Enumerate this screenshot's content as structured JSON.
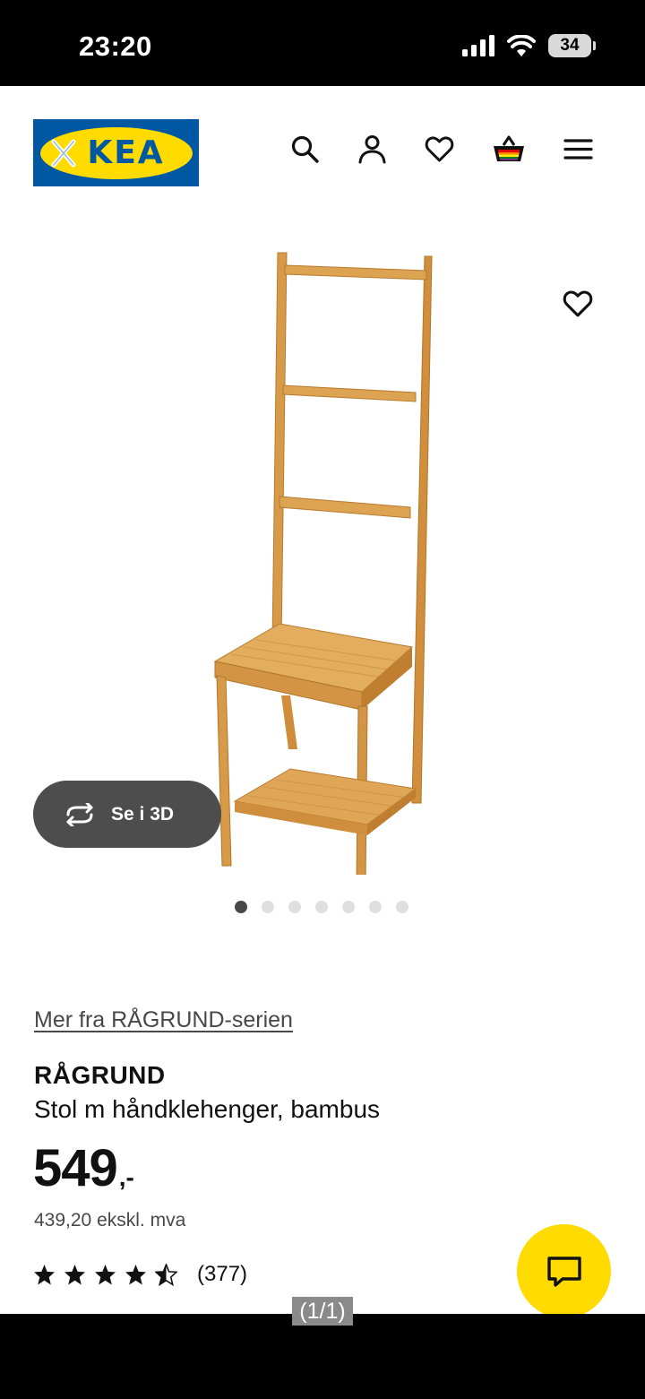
{
  "status_bar": {
    "time": "23:20",
    "battery": "34"
  },
  "header": {
    "logo_text": "KEA",
    "icons": [
      "search-icon",
      "user-icon",
      "heart-icon",
      "basket-icon",
      "menu-icon"
    ]
  },
  "gallery": {
    "view_3d_label": "Se i 3D",
    "image_count": 7,
    "active_index": 0
  },
  "product": {
    "series_link": "Mer fra RÅGRUND-serien",
    "name": "RÅGRUND",
    "description": "Stol m håndklehenger, bambus",
    "price_main": "549",
    "price_suffix": ",-",
    "price_ex_vat": "439,20 ekskl. mva",
    "rating_stars": 4.5,
    "rating_count": "(377)"
  },
  "viewer": {
    "page_indicator": "(1/1)"
  },
  "colors": {
    "ikea_blue": "#0058a3",
    "ikea_yellow": "#ffdb00",
    "text_dark": "#111111",
    "text_muted": "#484848"
  }
}
